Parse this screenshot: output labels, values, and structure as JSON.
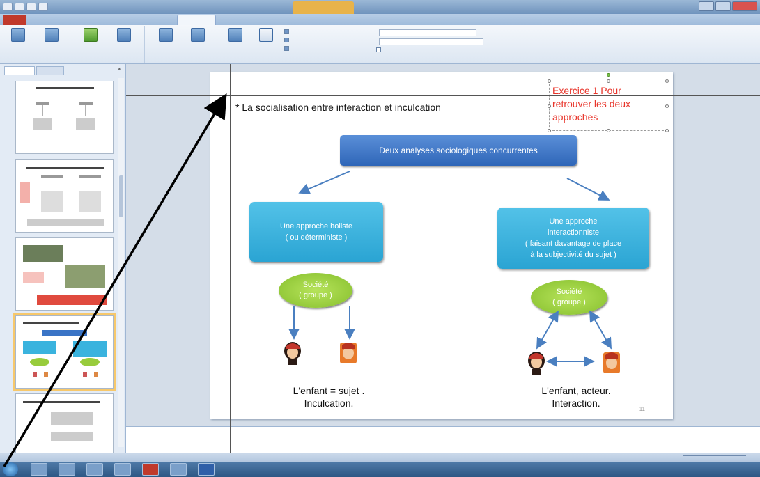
{
  "slide": {
    "title": "* La socialisation entre interaction et inculcation",
    "exercise_line1": "Exercice 1 Pour",
    "exercise_line2": "retrouver les deux",
    "exercise_line3": "approches",
    "top_box": "Deux analyses sociologiques concurrentes",
    "left_box_line1": "Une approche holiste",
    "left_box_line2": "( ou déterministe )",
    "right_box_line1": "Une approche",
    "right_box_line2": "interactionniste",
    "right_box_line3": "( faisant davantage de place",
    "right_box_line4": "à la subjectivité du sujet )",
    "left_oval_line1": "Société",
    "left_oval_line2": "( groupe )",
    "right_oval_line1": "Société",
    "right_oval_line2": "( groupe )",
    "left_caption_line1": "L'enfant = sujet .",
    "left_caption_line2": "Inculcation.",
    "right_caption_line1": "L'enfant, acteur.",
    "right_caption_line2": "Interaction.",
    "page_number": "11"
  },
  "colors": {
    "exercise_red": "#e8342a",
    "top_box_blue": "#3a74c6",
    "mid_box_cyan": "#3ab3de",
    "oval_green": "#98cc3c",
    "arrow_blue": "#4a7fc0"
  },
  "left_panel": {
    "slide_numbers": [
      "",
      "",
      "",
      "",
      ""
    ]
  }
}
